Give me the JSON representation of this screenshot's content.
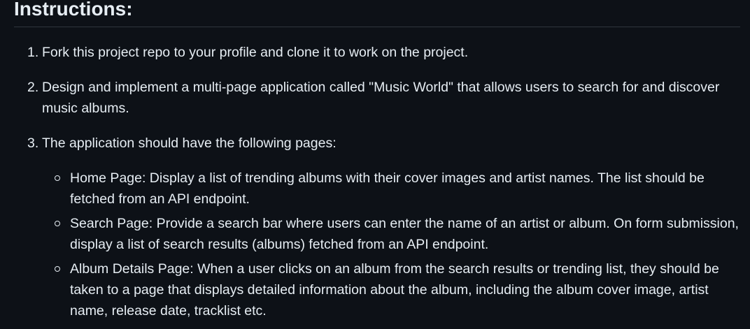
{
  "heading": "Instructions:",
  "steps": [
    {
      "num": "1.",
      "text": "Fork this project repo to your profile and clone it to work on the project."
    },
    {
      "num": "2.",
      "text": "Design and implement a multi-page application called \"Music World\" that allows users to search for and discover music albums."
    },
    {
      "num": "3.",
      "text": "The application should have the following pages:"
    }
  ],
  "pages": [
    "Home Page: Display a list of trending albums with their cover images and artist names. The list should be fetched from an API endpoint.",
    "Search Page: Provide a search bar where users can enter the name of an artist or album. On form submission, display a list of search results (albums) fetched from an API endpoint.",
    "Album Details Page: When a user clicks on an album from the search results or trending list, they should be taken to a page that displays detailed information about the album, including the album cover image, artist name, release date, tracklist etc."
  ]
}
